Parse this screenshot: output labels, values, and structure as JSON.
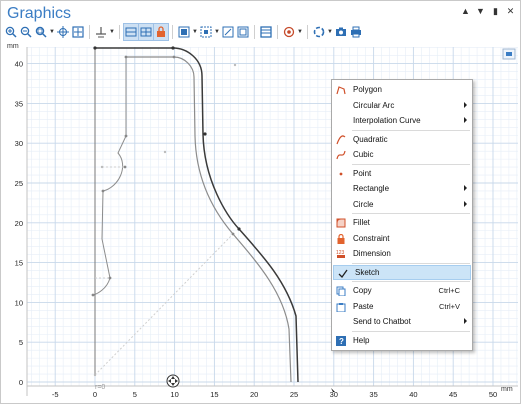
{
  "window": {
    "title": "Graphics"
  },
  "plot": {
    "unit_label": "mm",
    "x_ticks": [
      "-5",
      "0",
      "5",
      "10",
      "15",
      "20",
      "25",
      "30",
      "35",
      "40",
      "45",
      "50"
    ],
    "y_ticks": [
      "40",
      "35",
      "30",
      "25",
      "20",
      "15",
      "10",
      "5",
      "0"
    ],
    "r_label": "r=0"
  },
  "context_menu": {
    "items": [
      {
        "label": "Polygon",
        "icon": "polygon-icon"
      },
      {
        "label": "Circular Arc",
        "submenu": true
      },
      {
        "label": "Interpolation Curve",
        "submenu": true
      },
      {
        "label": "Quadratic",
        "icon": "quadratic-icon"
      },
      {
        "label": "Cubic",
        "icon": "cubic-icon"
      },
      {
        "label": "Point",
        "icon": "point-icon"
      },
      {
        "label": "Rectangle",
        "submenu": true
      },
      {
        "label": "Circle",
        "submenu": true
      },
      {
        "label": "Fillet",
        "icon": "fillet-icon"
      },
      {
        "label": "Constraint",
        "icon": "lock-icon"
      },
      {
        "label": "Dimension",
        "icon": "dimension-icon"
      },
      {
        "label": "Sketch",
        "icon": "checkmark-icon",
        "selected": true
      },
      {
        "label": "Copy",
        "shortcut": "Ctrl+C",
        "icon": "copy-icon"
      },
      {
        "label": "Paste",
        "shortcut": "Ctrl+V",
        "icon": "paste-icon"
      },
      {
        "label": "Send to Chatbot",
        "submenu": true
      },
      {
        "label": "Help",
        "icon": "help-icon"
      }
    ]
  },
  "colors": {
    "accent": "#3b7dc4",
    "grid_minor": "#e2ecf6",
    "grid_major": "#c8d8ea",
    "curve_dark": "#3a3a3a",
    "curve_light": "#8c8c8c",
    "selection": "#cce4f7"
  }
}
